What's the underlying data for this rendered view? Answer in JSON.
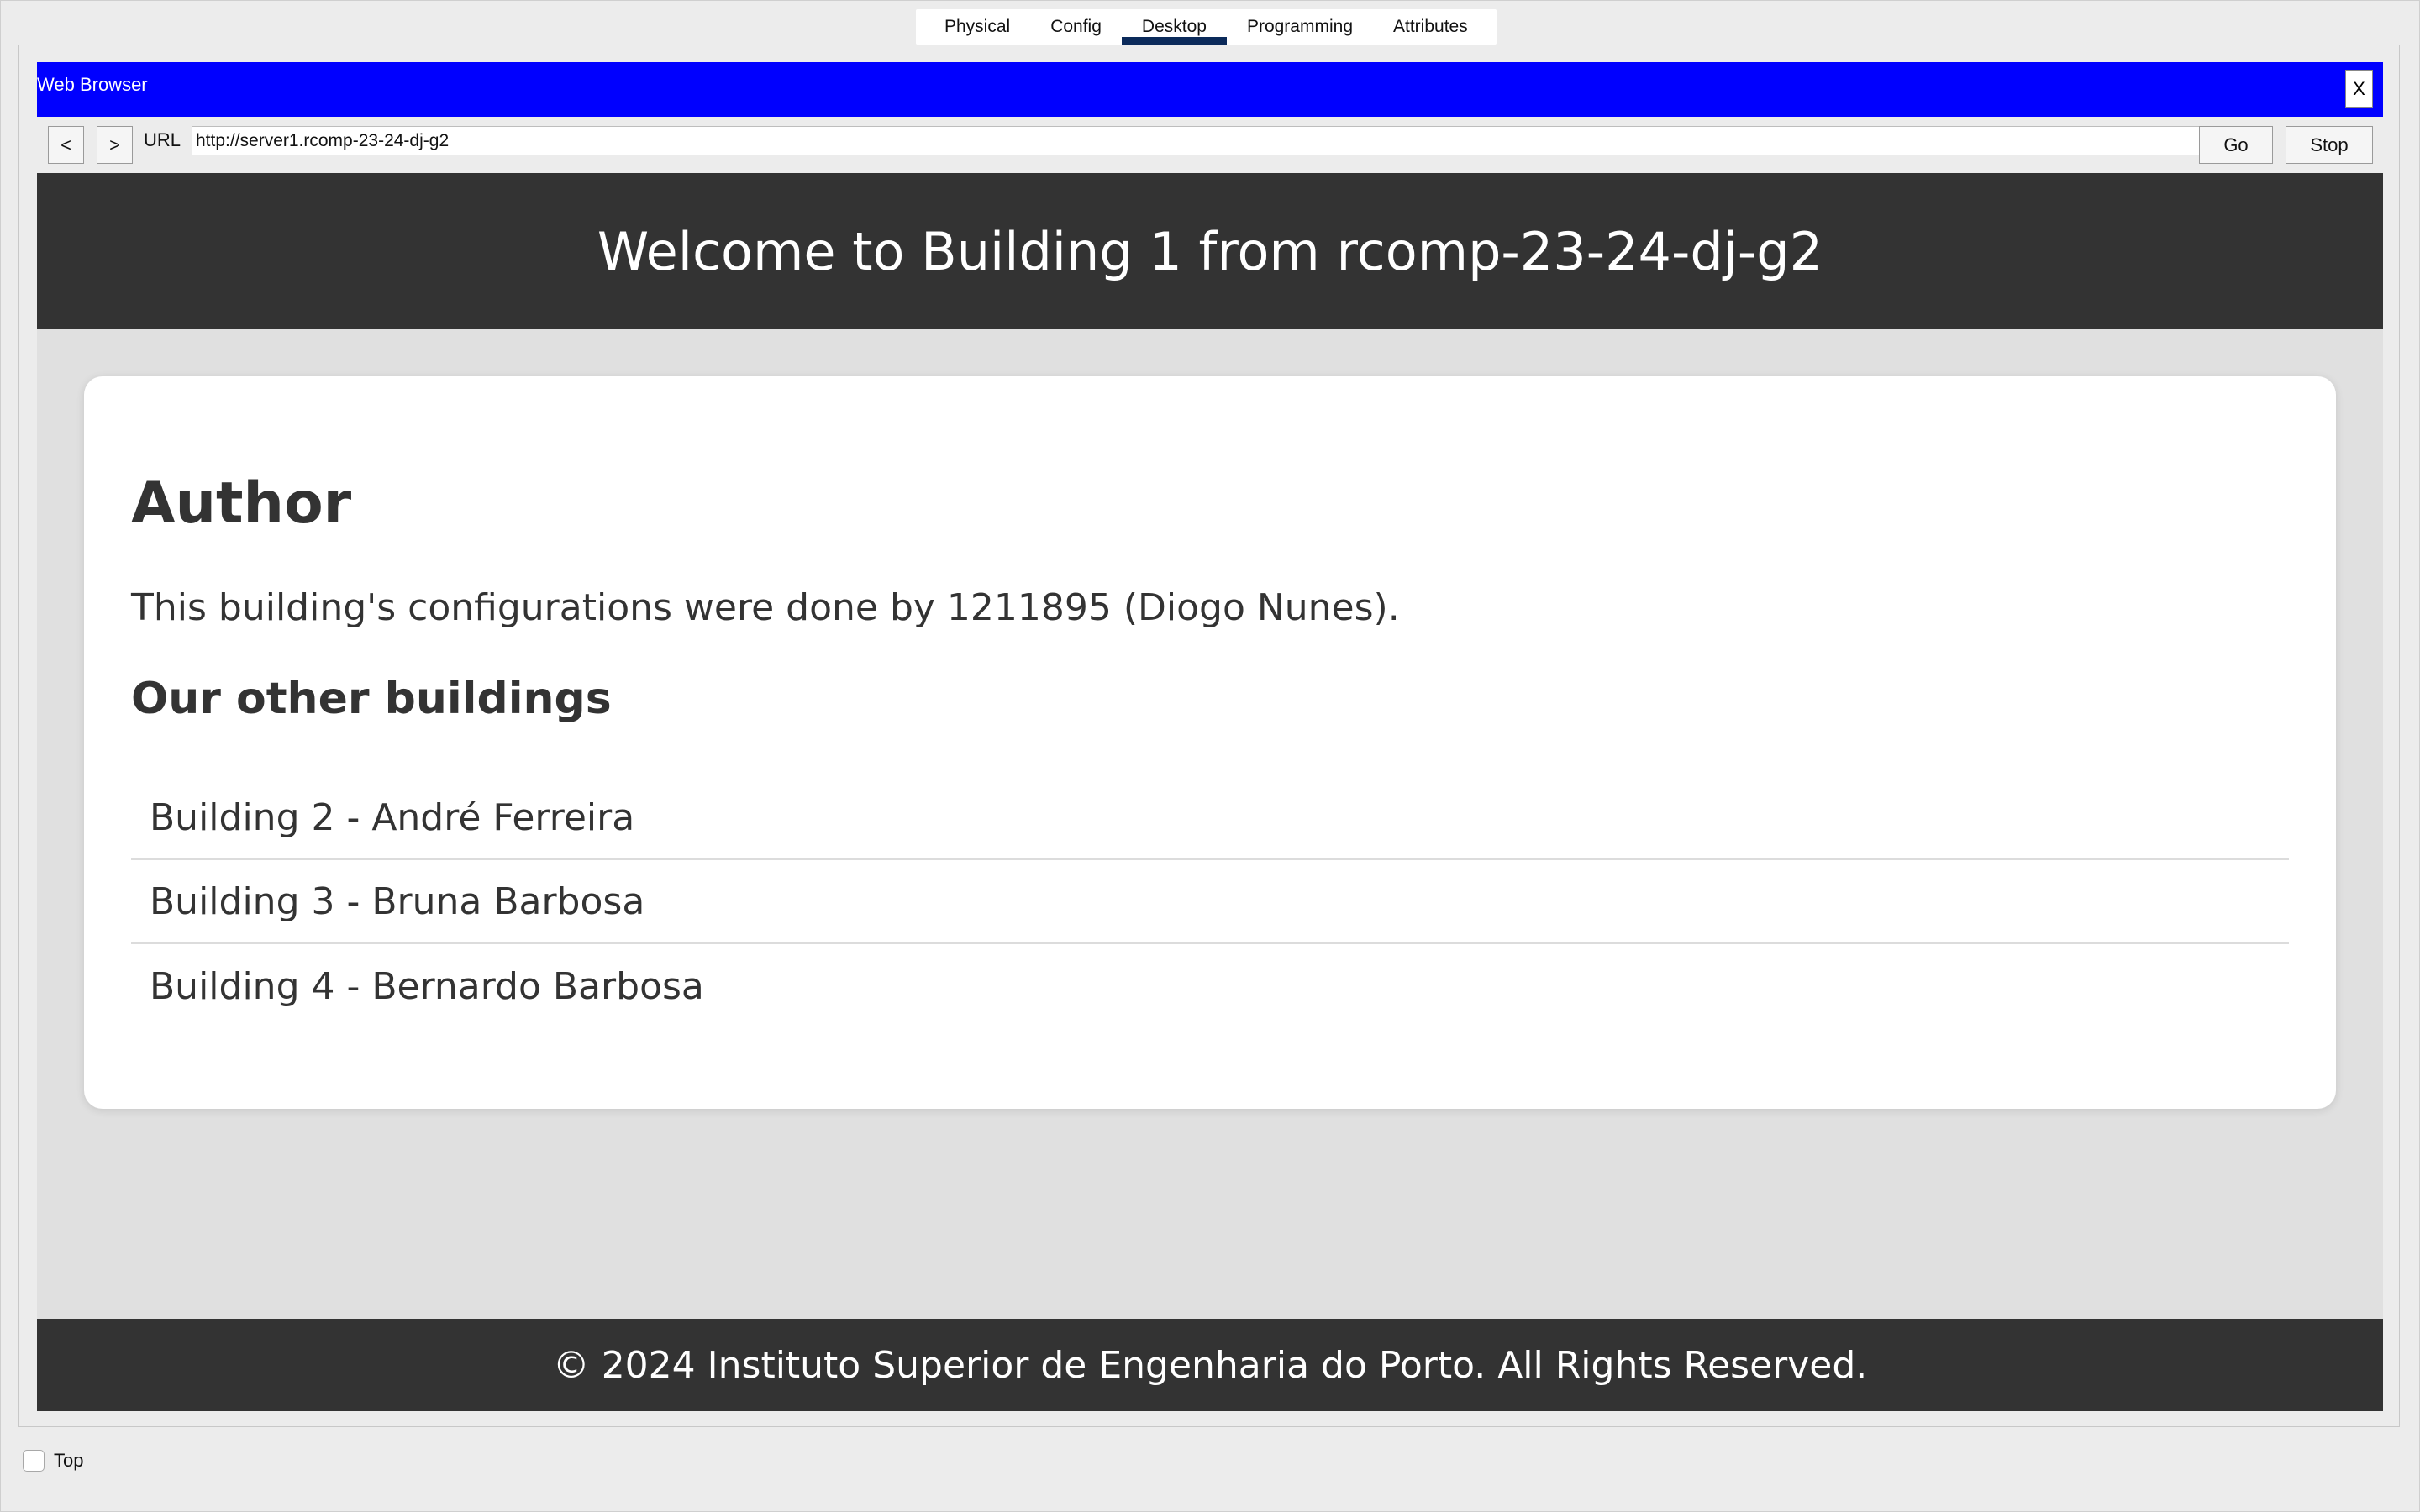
{
  "tabs": [
    {
      "label": "Physical"
    },
    {
      "label": "Config"
    },
    {
      "label": "Desktop",
      "active": true
    },
    {
      "label": "Programming"
    },
    {
      "label": "Attributes"
    }
  ],
  "browser": {
    "title": "Web Browser",
    "close_label": "X",
    "back_label": "<",
    "forward_label": ">",
    "url_label": "URL",
    "url_value": "http://server1.rcomp-23-24-dj-g2",
    "go_label": "Go",
    "stop_label": "Stop",
    "titlebar_color": "#0000ff"
  },
  "page": {
    "header_title": "Welcome to Building 1 from rcomp-23-24-dj-g2",
    "author_heading": "Author",
    "author_text": "This building's configurations were done by 1211895 (Diogo Nunes).",
    "other_heading": "Our other buildings",
    "buildings": [
      "Building 2 - André Ferreira",
      "Building 3 - Bruna Barbosa",
      "Building 4 - Bernardo Barbosa"
    ],
    "footer_text": "© 2024 Instituto Superior de Engenharia do Porto. All Rights Reserved."
  },
  "bottom": {
    "top_checkbox_label": "Top",
    "top_checked": false
  }
}
